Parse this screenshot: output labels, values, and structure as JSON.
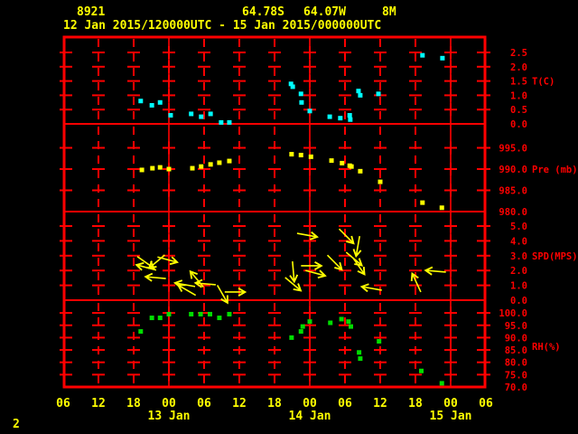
{
  "header": {
    "station_id": "8921",
    "latitude": "64.78S",
    "longitude": "64.07W",
    "elevation": "8M",
    "time_range": "12 Jan 2015/120000UTC - 15 Jan 2015/000000UTC"
  },
  "page_number": "2",
  "colors": {
    "background": "#000000",
    "frame": "#ff0000",
    "grid": "#ff0000",
    "right_labels": "#ff0000",
    "axis_text": "#ffff00",
    "temperature": "#00ffff",
    "pressure": "#ffff00",
    "wind": "#ffff00",
    "humidity": "#00dd00"
  },
  "x_axis": {
    "hour_labels": [
      "06",
      "12",
      "18",
      "00",
      "06",
      "12",
      "18",
      "00",
      "06",
      "12",
      "18",
      "00",
      "06"
    ],
    "date_labels": [
      {
        "label": "13 Jan",
        "hour_index": 3
      },
      {
        "label": "14 Jan",
        "hour_index": 7
      },
      {
        "label": "15 Jan",
        "hour_index": 11
      }
    ],
    "note": "x values below are hours after the first tick (06 UTC 12 Jan 2015); ticks every 6 h, 72 h total"
  },
  "chart_data": {
    "type": "meteogram",
    "title": "Station 8921 surface meteogram",
    "panels": [
      {
        "name": "temperature",
        "ylabel": "T(C)",
        "type": "scatter",
        "marker": "square",
        "color_key": "temperature",
        "yticks": [
          2.5,
          2.0,
          1.5,
          1.0,
          0.5,
          0.0
        ],
        "ytick_labels": [
          "2.5",
          "2.0",
          "1.5",
          "1.0",
          "0.5",
          "0.0"
        ],
        "unit_label_value": 1.5,
        "ylim": [
          0.0,
          3.0
        ],
        "point_format": "[hours, degC]",
        "points": [
          [
            13.2,
            0.8
          ],
          [
            15.1,
            0.65
          ],
          [
            16.5,
            0.75
          ],
          [
            18.3,
            0.3
          ],
          [
            21.8,
            0.35
          ],
          [
            23.5,
            0.25
          ],
          [
            25.1,
            0.35
          ],
          [
            26.9,
            0.05
          ],
          [
            28.3,
            0.05
          ],
          [
            38.8,
            1.4
          ],
          [
            39.1,
            1.3
          ],
          [
            40.5,
            1.05
          ],
          [
            40.6,
            0.75
          ],
          [
            42.0,
            0.45
          ],
          [
            45.4,
            0.25
          ],
          [
            47.2,
            0.2
          ],
          [
            48.8,
            0.3
          ],
          [
            48.9,
            0.15
          ],
          [
            50.3,
            1.15
          ],
          [
            50.6,
            1.0
          ],
          [
            53.7,
            1.05
          ],
          [
            61.2,
            2.4
          ],
          [
            64.6,
            2.3
          ]
        ]
      },
      {
        "name": "pressure",
        "ylabel": "Pre (mb)",
        "type": "scatter",
        "marker": "square",
        "color_key": "pressure",
        "yticks": [
          995.0,
          990.0,
          985.0,
          980.0
        ],
        "ytick_labels": [
          "995.0",
          "990.0",
          "985.0",
          "980.0"
        ],
        "unit_label_value": 990.0,
        "ylim": [
          980.0,
          997.0
        ],
        "point_format": "[hours, mb]",
        "points": [
          [
            13.4,
            989.8
          ],
          [
            15.2,
            990.2
          ],
          [
            16.5,
            990.4
          ],
          [
            18.0,
            990.0
          ],
          [
            22.0,
            990.2
          ],
          [
            23.5,
            990.6
          ],
          [
            25.1,
            991.1
          ],
          [
            26.6,
            991.5
          ],
          [
            28.3,
            991.9
          ],
          [
            38.9,
            993.5
          ],
          [
            40.5,
            993.3
          ],
          [
            42.2,
            992.9
          ],
          [
            45.7,
            992.0
          ],
          [
            47.5,
            991.4
          ],
          [
            48.8,
            990.8
          ],
          [
            49.1,
            990.6
          ],
          [
            50.6,
            989.5
          ],
          [
            54.0,
            987.0
          ],
          [
            61.2,
            982.1
          ],
          [
            64.5,
            980.9
          ]
        ]
      },
      {
        "name": "wind_speed",
        "ylabel": "SPD(MPS)",
        "type": "vector",
        "color_key": "wind",
        "yticks": [
          5.0,
          4.0,
          3.0,
          2.0,
          1.0,
          0.0
        ],
        "ytick_labels": [
          "5.0",
          "4.0",
          "3.0",
          "2.0",
          "1.0",
          "0.0"
        ],
        "unit_label_value": 3.0,
        "ylim": [
          0.0,
          6.0
        ],
        "point_format": "[hours, mps, arrow_angle_deg (0=right, clockwise on screen)]",
        "points": [
          [
            14.0,
            2.56,
            35
          ],
          [
            16.0,
            2.62,
            140
          ],
          [
            17.7,
            2.74,
            15
          ],
          [
            14.2,
            2.2,
            195
          ],
          [
            15.8,
            1.52,
            185
          ],
          [
            20.8,
            1.04,
            190
          ],
          [
            21.1,
            0.67,
            210
          ],
          [
            22.8,
            1.4,
            230
          ],
          [
            24.3,
            1.1,
            185
          ],
          [
            27.1,
            0.43,
            60
          ],
          [
            29.2,
            0.55,
            0
          ],
          [
            41.5,
            4.39,
            10
          ],
          [
            48.2,
            4.33,
            45
          ],
          [
            50.2,
            3.66,
            100
          ],
          [
            49.5,
            2.8,
            40
          ],
          [
            50.3,
            2.32,
            55
          ],
          [
            46.2,
            2.56,
            45
          ],
          [
            42.2,
            2.32,
            0
          ],
          [
            42.9,
            1.83,
            15
          ],
          [
            39.2,
            1.95,
            85
          ],
          [
            39.1,
            1.1,
            40
          ],
          [
            52.6,
            0.79,
            190
          ],
          [
            60.2,
            1.16,
            245
          ],
          [
            63.5,
            1.95,
            185
          ]
        ]
      },
      {
        "name": "relative_humidity",
        "ylabel": "RH(%)",
        "type": "scatter",
        "marker": "square",
        "color_key": "humidity",
        "yticks": [
          100.0,
          95.0,
          90.0,
          85.0,
          80.0,
          75.0,
          70.0
        ],
        "ytick_labels": [
          "100.0",
          "95.0",
          "90.0",
          "85.0",
          "80.0",
          "75.0",
          "70.0"
        ],
        "unit_label_value": 86.5,
        "ylim": [
          70.0,
          102.0
        ],
        "point_format": "[hours, percent]",
        "points": [
          [
            13.2,
            92.5
          ],
          [
            15.1,
            98.0
          ],
          [
            16.5,
            98.0
          ],
          [
            18.0,
            99.5
          ],
          [
            21.8,
            99.5
          ],
          [
            23.4,
            99.5
          ],
          [
            25.0,
            99.5
          ],
          [
            26.6,
            98.0
          ],
          [
            28.3,
            99.5
          ],
          [
            38.9,
            90.0
          ],
          [
            40.5,
            92.5
          ],
          [
            40.8,
            94.5
          ],
          [
            42.0,
            96.5
          ],
          [
            45.5,
            96.0
          ],
          [
            47.4,
            97.5
          ],
          [
            48.6,
            96.5
          ],
          [
            49.0,
            94.5
          ],
          [
            50.4,
            84.0
          ],
          [
            50.6,
            81.5
          ],
          [
            53.8,
            88.5
          ],
          [
            61.0,
            76.5
          ],
          [
            64.5,
            71.5
          ]
        ]
      }
    ]
  }
}
